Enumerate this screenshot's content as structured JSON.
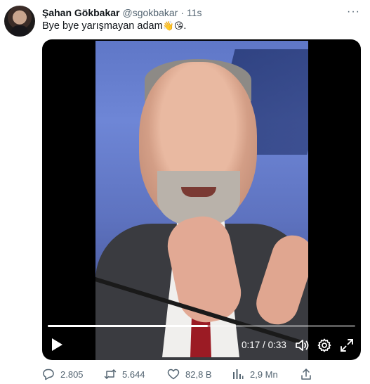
{
  "tweet": {
    "author_name": "Şahan Gökbakar",
    "author_handle": "@sgokbakar",
    "separator": "·",
    "time": "11s",
    "more_icon": "ellipsis-icon",
    "text": "Bye bye yarışmayan adam",
    "emojis": [
      "👋",
      "😘"
    ],
    "text_end": "."
  },
  "video": {
    "current_time": "0:17",
    "time_separator": "/",
    "duration": "0:33",
    "progress": 0.52,
    "play_icon": "play-icon",
    "volume_icon": "volume-icon",
    "settings_icon": "gear-icon",
    "fullscreen_icon": "fullscreen-icon"
  },
  "actions": {
    "replies": "2.805",
    "retweets": "5.644",
    "likes": "82,8 B",
    "views": "2,9 Mn"
  },
  "colors": {
    "text_primary": "#0f1419",
    "text_secondary": "#536471",
    "video_bg": "#000000"
  }
}
